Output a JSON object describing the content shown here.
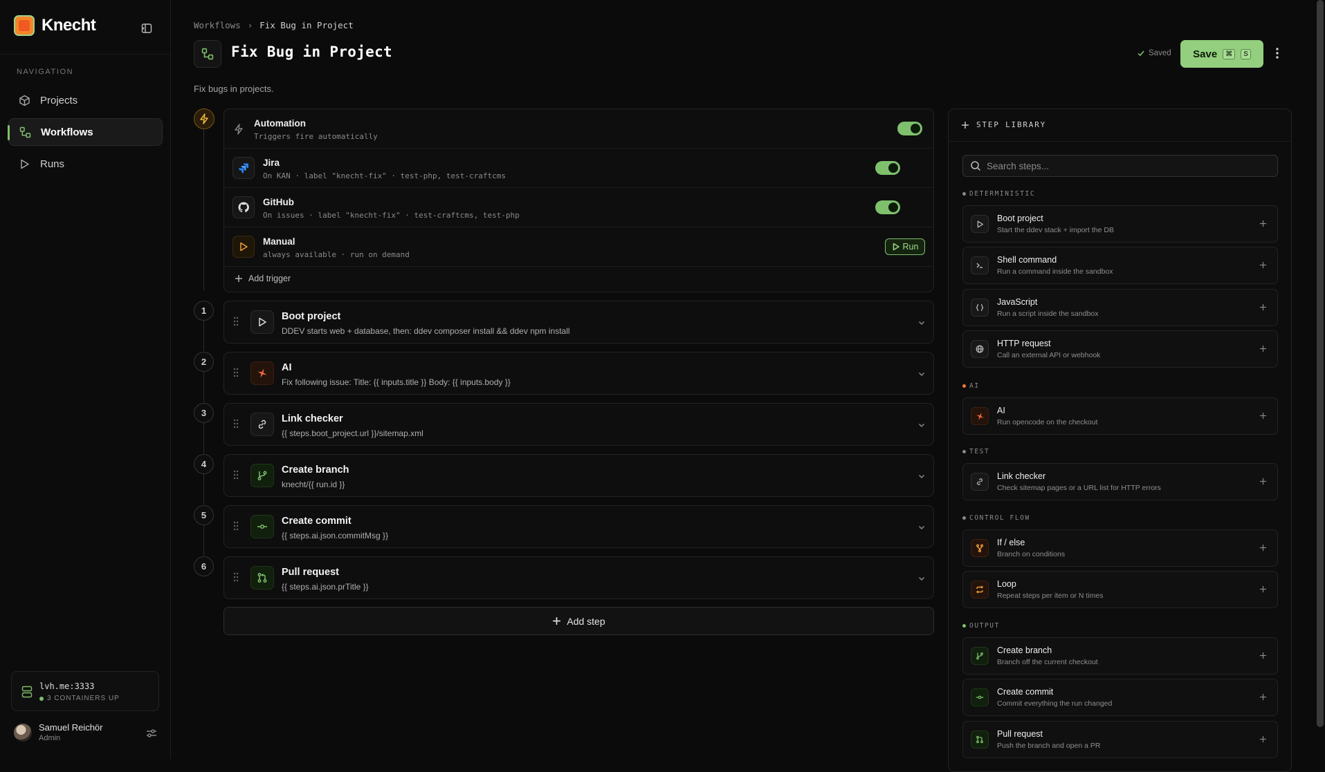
{
  "app": {
    "name": "Knecht"
  },
  "nav": {
    "label": "NAVIGATION",
    "items": [
      {
        "label": "Projects"
      },
      {
        "label": "Workflows"
      },
      {
        "label": "Runs"
      }
    ]
  },
  "status": {
    "host": "lvh.me:3333",
    "containers": "3 CONTAINERS UP"
  },
  "user": {
    "name": "Samuel Reichör",
    "role": "Admin"
  },
  "breadcrumb": {
    "parent": "Workflows",
    "sep": "›",
    "current": "Fix Bug in Project"
  },
  "page": {
    "title": "Fix Bug in Project",
    "description": "Fix bugs in projects.",
    "saved": "Saved",
    "save_label": "Save",
    "kbd_cmd": "⌘",
    "kbd_key": "S"
  },
  "triggers": {
    "header": {
      "title": "Automation",
      "subtitle": "Triggers fire automatically",
      "enabled": true
    },
    "items": [
      {
        "name": "Jira",
        "detail": "On KAN · label \"knecht-fix\" · test-php, test-craftcms",
        "enabled": true
      },
      {
        "name": "GitHub",
        "detail": "On issues · label \"knecht-fix\" · test-craftcms, test-php",
        "enabled": true
      },
      {
        "name": "Manual",
        "detail": "always available · run on demand",
        "action": "Run"
      }
    ],
    "add_label": "Add trigger"
  },
  "steps": [
    {
      "n": "1",
      "title": "Boot project",
      "detail": "DDEV starts web + database, then: ddev composer install && ddev npm install",
      "icon": "play-icon"
    },
    {
      "n": "2",
      "title": "AI",
      "detail": "Fix following issue: Title: {{ inputs.title }} Body: {{ inputs.body }}",
      "icon": "ai-icon"
    },
    {
      "n": "3",
      "title": "Link checker",
      "detail": "{{ steps.boot_project.url }}/sitemap.xml",
      "icon": "link-icon"
    },
    {
      "n": "4",
      "title": "Create branch",
      "detail": "knecht/{{ run.id }}",
      "icon": "branch-icon"
    },
    {
      "n": "5",
      "title": "Create commit",
      "detail": "{{ steps.ai.json.commitMsg }}",
      "icon": "commit-icon"
    },
    {
      "n": "6",
      "title": "Pull request",
      "detail": "{{ steps.ai.json.prTitle }}",
      "icon": "pull-request-icon"
    }
  ],
  "add_step_label": "Add step",
  "library": {
    "title": "STEP LIBRARY",
    "search_placeholder": "Search steps...",
    "categories": [
      {
        "label": "DETERMINISTIC",
        "color": "#8a8a8a",
        "items": [
          {
            "name": "Boot project",
            "desc": "Start the ddev stack + import the DB"
          },
          {
            "name": "Shell command",
            "desc": "Run a command inside the sandbox"
          },
          {
            "name": "JavaScript",
            "desc": "Run a script inside the sandbox"
          },
          {
            "name": "HTTP request",
            "desc": "Call an external API or webhook"
          }
        ]
      },
      {
        "label": "AI",
        "color": "#f07a3a",
        "items": [
          {
            "name": "AI",
            "desc": "Run opencode on the checkout"
          }
        ]
      },
      {
        "label": "TEST",
        "color": "#8a8a8a",
        "items": [
          {
            "name": "Link checker",
            "desc": "Check sitemap pages or a URL list for HTTP errors"
          }
        ]
      },
      {
        "label": "CONTROL FLOW",
        "color": "#8a8a8a",
        "items": [
          {
            "name": "If / else",
            "desc": "Branch on conditions"
          },
          {
            "name": "Loop",
            "desc": "Repeat steps per item or N times"
          }
        ]
      },
      {
        "label": "OUTPUT",
        "color": "#7fc06d",
        "items": [
          {
            "name": "Create branch",
            "desc": "Branch off the current checkout"
          },
          {
            "name": "Create commit",
            "desc": "Commit everything the run changed"
          },
          {
            "name": "Pull request",
            "desc": "Push the branch and open a PR"
          }
        ]
      }
    ]
  }
}
